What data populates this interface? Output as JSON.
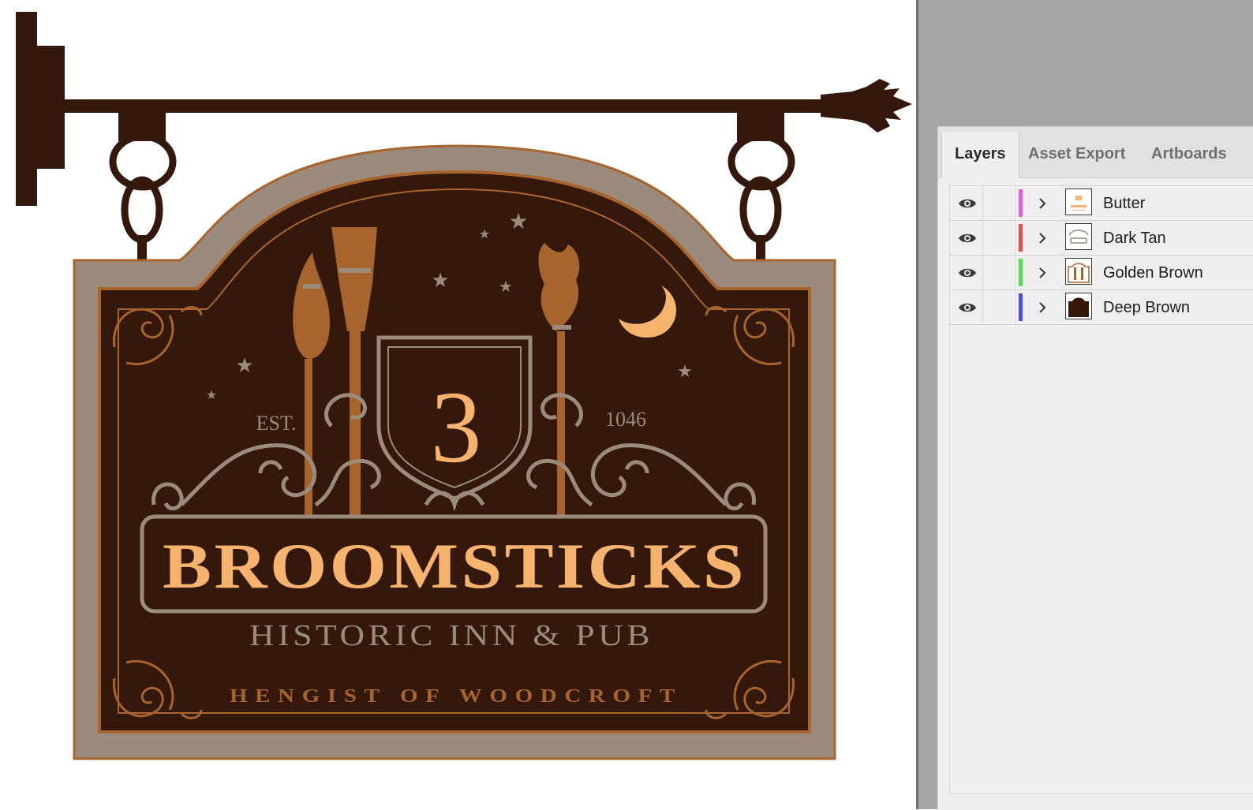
{
  "artwork": {
    "sign": {
      "est_label": "EST.",
      "year": "1046",
      "crest_number": "3",
      "name": "BROOMSTICKS",
      "subtitle": "HISTORIC INN & PUB",
      "location": "HENGIST OF WOODCROFT"
    },
    "colors": {
      "deep_brown": "#33180b",
      "golden_brown": "#a8642d",
      "dark_tan": "#9b8b7c",
      "butter": "#f6b36d"
    }
  },
  "panel": {
    "tabs": [
      {
        "label": "Layers",
        "active": true
      },
      {
        "label": "Asset Export",
        "active": false
      },
      {
        "label": "Artboards",
        "active": false
      }
    ],
    "layers": [
      {
        "name": "Butter",
        "color": "#ee55ee",
        "visible": true,
        "thumb": "butter-thumb"
      },
      {
        "name": "Dark Tan",
        "color": "#ee4a4a",
        "visible": true,
        "thumb": "dark-tan-thumb"
      },
      {
        "name": "Golden Brown",
        "color": "#4ee44e",
        "visible": true,
        "thumb": "golden-brown-thumb"
      },
      {
        "name": "Deep Brown",
        "color": "#4a4aee",
        "visible": true,
        "thumb": "deep-brown-thumb"
      }
    ]
  }
}
